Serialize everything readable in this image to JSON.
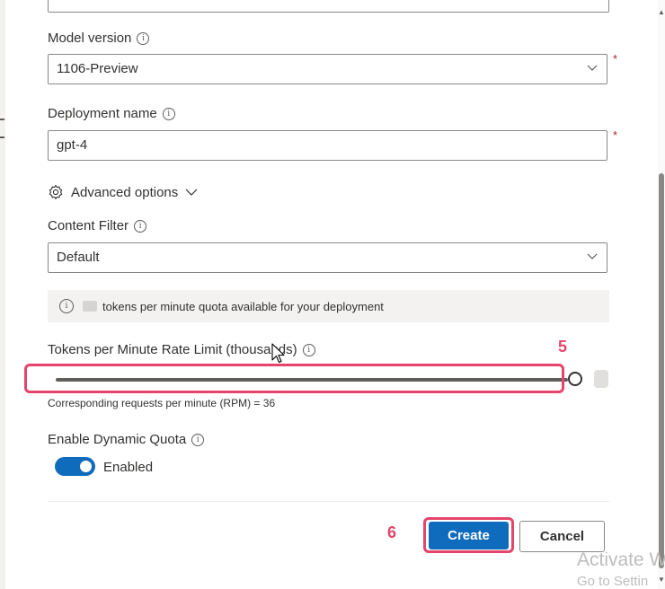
{
  "model_version": {
    "label": "Model version",
    "value": "1106-Preview",
    "required_mark": "*"
  },
  "deployment_name": {
    "label": "Deployment name",
    "value": "gpt-4",
    "required_mark": "*"
  },
  "advanced_options": {
    "label": "Advanced options"
  },
  "content_filter": {
    "label": "Content Filter",
    "value": "Default"
  },
  "quota_info": {
    "text": "tokens per minute quota available for your deployment"
  },
  "rate_limit": {
    "label": "Tokens per Minute Rate Limit (thousands)",
    "slider_fraction": 1.0,
    "rpm_text": "Corresponding requests per minute (RPM) = 36"
  },
  "dynamic_quota": {
    "label": "Enable Dynamic Quota",
    "state_label": "Enabled",
    "enabled": true
  },
  "steps": {
    "step5": "5",
    "step6": "6"
  },
  "buttons": {
    "create": "Create",
    "cancel": "Cancel"
  },
  "watermark": {
    "line1": "Activate W",
    "line2": "Go to Settin"
  },
  "colors": {
    "primary": "#0f6cbd",
    "highlight": "#e5446d",
    "required": "#a4262c"
  },
  "icons": {
    "info": "info-icon",
    "chevron": "chevron-down-icon",
    "gear": "gear-icon"
  }
}
